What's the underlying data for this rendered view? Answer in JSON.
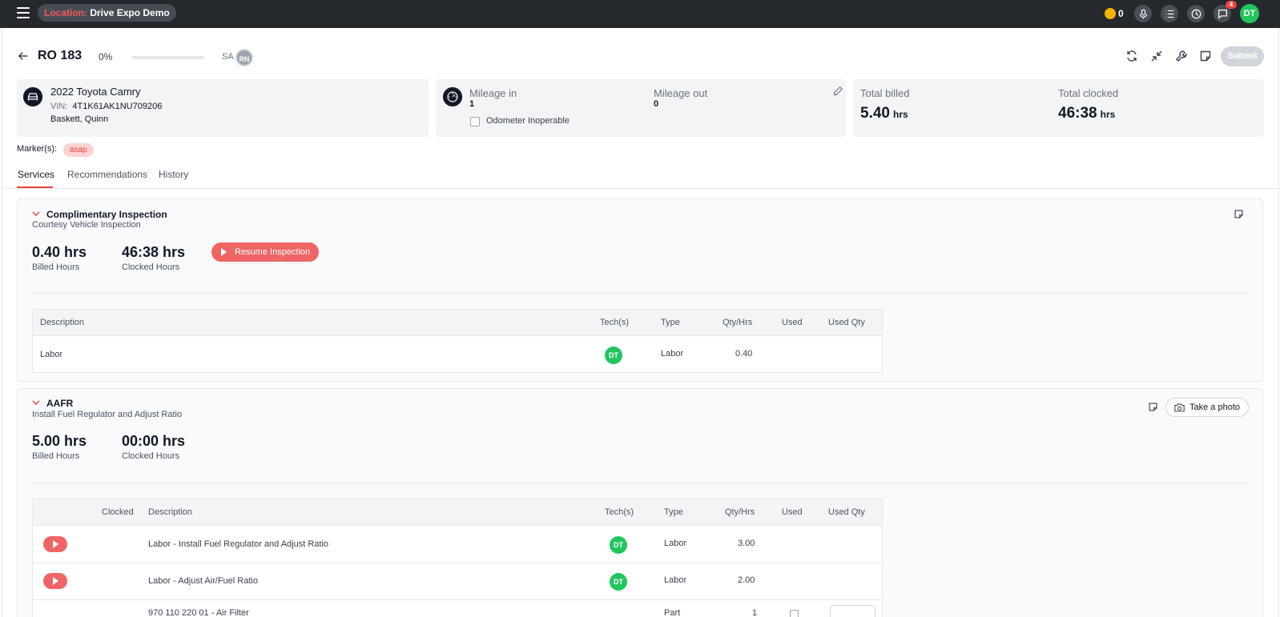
{
  "topbar": {
    "location_label": "Location:",
    "location_name": "Drive Expo Demo",
    "coin_count": "0",
    "notification_count": "4",
    "user_initials": "DT"
  },
  "ro": {
    "title": "RO 183",
    "progress_text": "0%",
    "progress_fraction": 0,
    "sa_label": "SA",
    "sa_initials": "RN",
    "submit_label": "Submit"
  },
  "vehicle": {
    "name": "2022 Toyota Camry",
    "vin_label": "VIN:",
    "vin": "4T1K61AK1NU709206",
    "owner": "Baskett, Quinn"
  },
  "mileage": {
    "in_label": "Mileage in",
    "in_value": "1",
    "out_label": "Mileage out",
    "out_value": "0",
    "odometer_label": "Odometer Inoperable"
  },
  "totals": {
    "billed_label": "Total billed",
    "billed_value": "5.40",
    "billed_unit": "hrs",
    "clocked_label": "Total clocked",
    "clocked_value": "46:38",
    "clocked_unit": "hrs"
  },
  "markers": {
    "label": "Marker(s):",
    "badge": "asap"
  },
  "tabs": [
    {
      "label": "Services"
    },
    {
      "label": "Recommendations"
    },
    {
      "label": "History"
    }
  ],
  "services": [
    {
      "title": "Complimentary Inspection",
      "subtitle": "Courtesy Vehicle Inspection",
      "billed": "0.40 hrs",
      "billed_label": "Billed Hours",
      "clocked": "46:38 hrs",
      "clocked_label": "Clocked Hours",
      "action_label": "Resume Inspection",
      "columns": [
        "Description",
        "Tech(s)",
        "Type",
        "Qty/Hrs",
        "Used",
        "Used Qty"
      ],
      "rows": [
        {
          "description": "Labor",
          "tech": "DT",
          "type": "Labor",
          "qty": "0.40"
        }
      ]
    },
    {
      "title": "AAFR",
      "subtitle": "Install Fuel Regulator and Adjust Ratio",
      "billed": "5.00 hrs",
      "billed_label": "Billed Hours",
      "clocked": "00:00 hrs",
      "clocked_label": "Clocked Hours",
      "photo_label": "Take a photo",
      "columns": [
        "Clocked",
        "Description",
        "Tech(s)",
        "Type",
        "Qty/Hrs",
        "Used",
        "Used Qty"
      ],
      "rows": [
        {
          "description": "Labor - Install Fuel Regulator and Adjust Ratio",
          "tech": "DT",
          "type": "Labor",
          "qty": "3.00"
        },
        {
          "description": "Labor - Adjust Air/Fuel Ratio",
          "tech": "DT",
          "type": "Labor",
          "qty": "2.00"
        },
        {
          "description": "970 110 220 01 - Air Filter",
          "tech": "",
          "type": "Part",
          "qty": "1"
        }
      ]
    }
  ],
  "icons": {
    "menu": "hamburger-icon",
    "coin": "coin-icon",
    "mic": "microphone-icon",
    "list": "list-icon",
    "clock": "clock-icon",
    "chat": "chat-icon",
    "back": "arrow-left-icon",
    "refresh": "refresh-icon",
    "collapse": "collapse-icon",
    "wrench": "wrench-icon",
    "note": "note-icon",
    "car": "car-icon",
    "speedometer": "speedometer-icon",
    "pencil": "pencil-icon",
    "camera": "camera-icon",
    "chevron": "chevron-down-icon",
    "play": "play-icon"
  },
  "colors": {
    "topbar_bg": "#25282d",
    "accent_red": "#ef4444",
    "button_red": "#ef6565",
    "tech_green": "#22c55e",
    "coin_yellow": "#f5b400",
    "marker_bg": "#fbd3d3"
  }
}
